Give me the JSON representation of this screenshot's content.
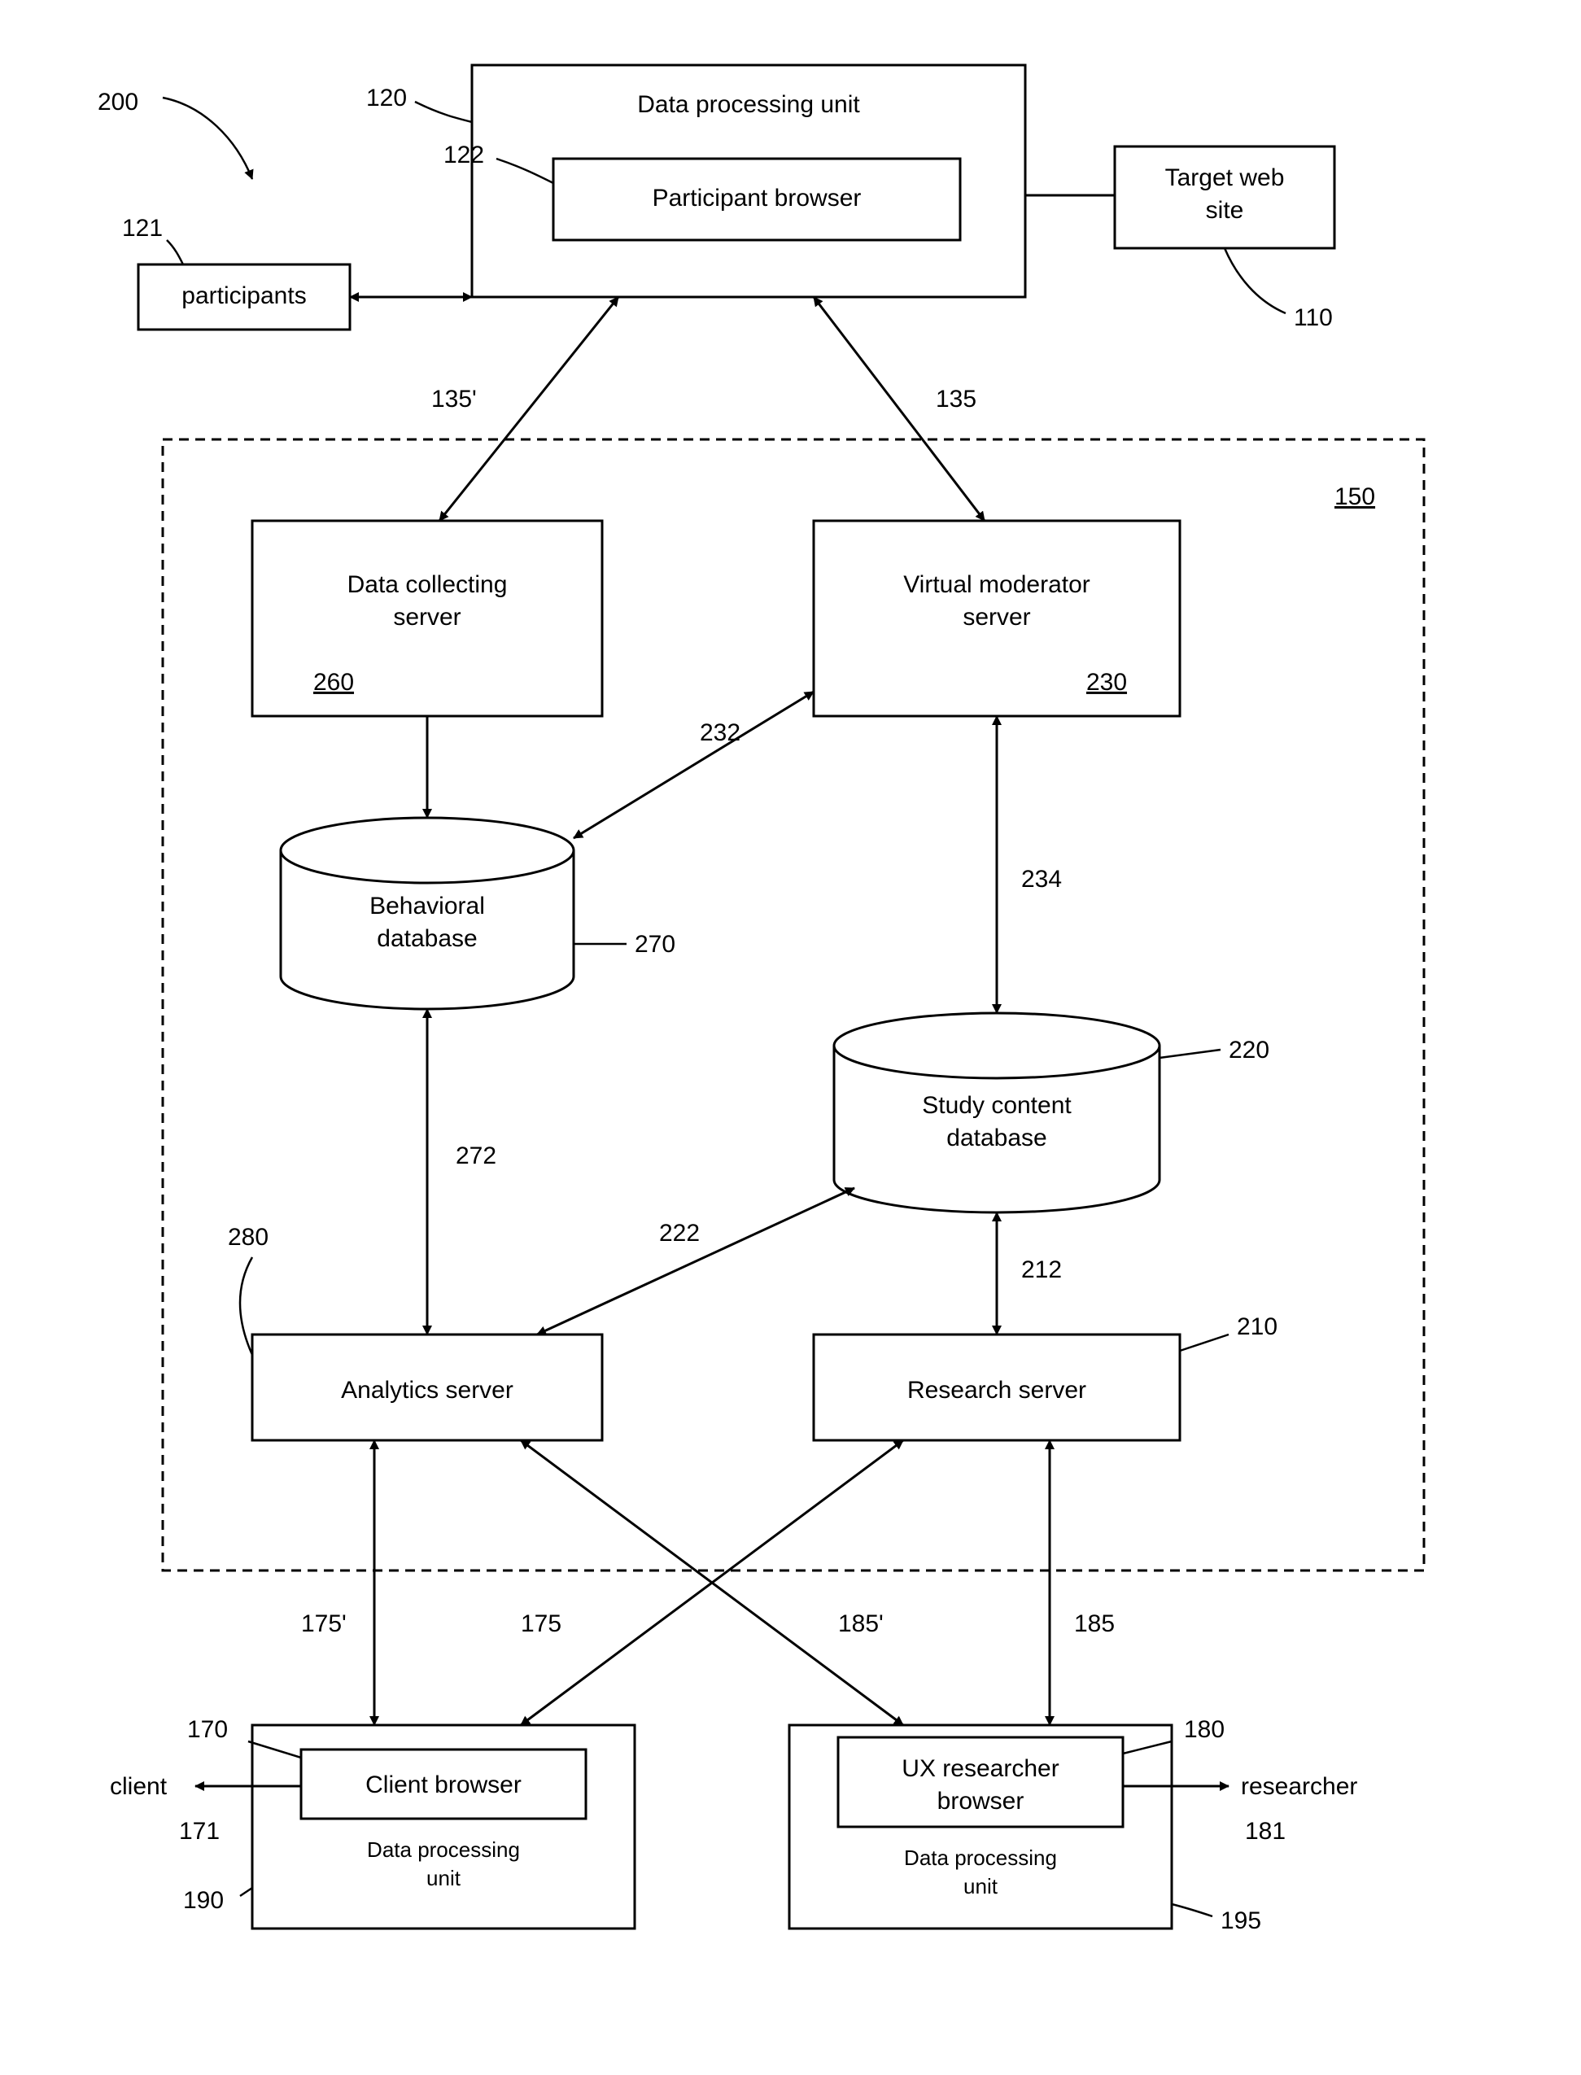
{
  "fig": {
    "ref200": "200",
    "dpu_top": {
      "title": "Data processing unit",
      "ref": "120",
      "browser": "Participant browser",
      "browser_ref": "122"
    },
    "target": {
      "l1": "Target web",
      "l2": "site",
      "ref": "110"
    },
    "participants": {
      "label": "participants",
      "ref": "121"
    },
    "conn_top": {
      "left": "135'",
      "right": "135"
    },
    "sys150": "150",
    "dcs": {
      "l1": "Data collecting",
      "l2": "server",
      "ref": "260"
    },
    "vms": {
      "l1": "Virtual moderator",
      "l2": "server",
      "ref": "230"
    },
    "link232": "232",
    "link234": "234",
    "bdb": {
      "l1": "Behavioral",
      "l2": "database",
      "ref": "270"
    },
    "link272": "272",
    "scd": {
      "l1": "Study content",
      "l2": "database",
      "ref": "220"
    },
    "link222": "222",
    "link212": "212",
    "aserv": {
      "label": "Analytics server",
      "ref": "280"
    },
    "rserv": {
      "label": "Research server",
      "ref": "210"
    },
    "bot_links": {
      "l175p": "175'",
      "l175": "175",
      "l185p": "185'",
      "l185": "185"
    },
    "client": {
      "browser": "Client browser",
      "unit": "Data processing\nunit",
      "ref_browser": "170",
      "ref_unit": "190",
      "actor": "client",
      "actor_ref": "171"
    },
    "ux": {
      "browser_l1": "UX researcher",
      "browser_l2": "browser",
      "unit": "Data processing\nunit",
      "ref_browser": "180",
      "ref_unit": "195",
      "actor": "researcher",
      "actor_ref": "181"
    }
  }
}
